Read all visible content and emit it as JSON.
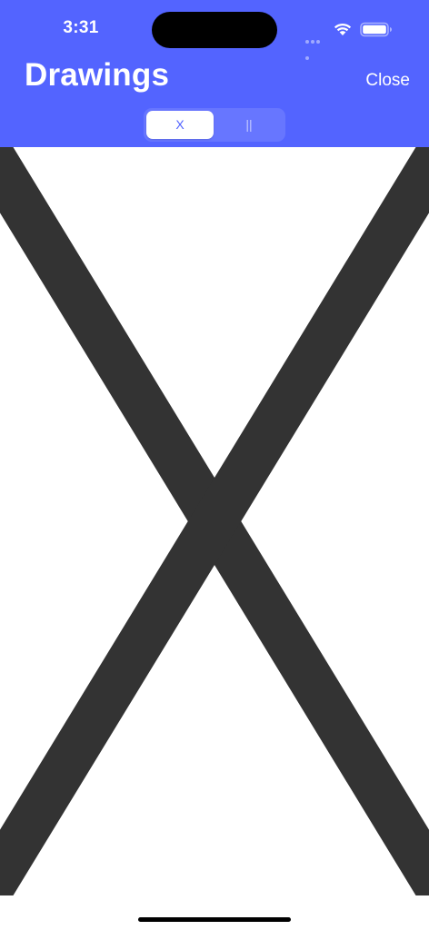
{
  "status_bar": {
    "time": "3:31"
  },
  "header": {
    "title": "Drawings",
    "close_label": "Close",
    "background_color": "#5364ff"
  },
  "segmented_control": {
    "segments": [
      {
        "label": "X",
        "selected": true
      },
      {
        "label": "||",
        "selected": false
      }
    ]
  },
  "canvas": {
    "drawing": "X",
    "stroke_color": "#333333"
  }
}
